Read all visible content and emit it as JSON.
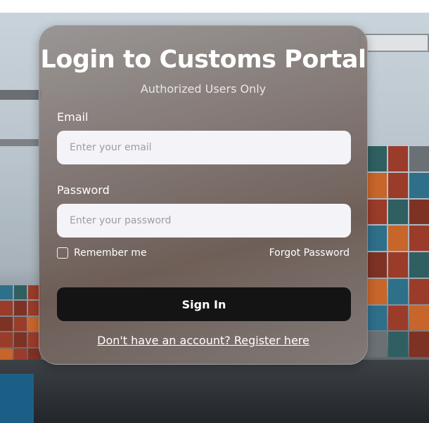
{
  "login": {
    "title": "Login to Customs Portal",
    "subtitle": "Authorized Users Only",
    "email_label": "Email",
    "email_placeholder": "Enter your email",
    "email_value": "",
    "password_label": "Password",
    "password_placeholder": "Enter your password",
    "password_value": "",
    "remember_label": "Remember me",
    "remember_checked": false,
    "forgot_link": "Forgot Password",
    "signin_button": "Sign In",
    "register_link": "Don't have an account? Register here"
  },
  "colors": {
    "button_bg": "#141414",
    "input_bg": "#f4f4f8",
    "text": "#ffffff"
  }
}
